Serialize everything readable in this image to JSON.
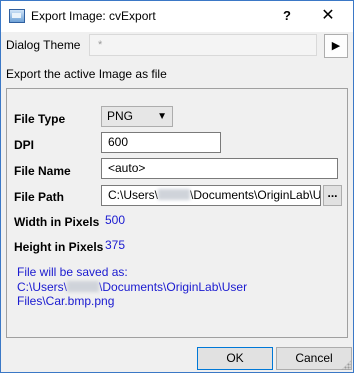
{
  "window": {
    "title": "Export Image: cvExport",
    "help_label": "?",
    "close_label": "✕"
  },
  "theme": {
    "label": "Dialog Theme",
    "value": "*",
    "arrow": "▶"
  },
  "description": "Export the active Image as file",
  "fields": {
    "file_type": {
      "label": "File Type",
      "value": "PNG",
      "chevron": "▼"
    },
    "dpi": {
      "label": "DPI",
      "value": "600"
    },
    "file_name": {
      "label": "File Name",
      "value": "<auto>"
    },
    "file_path": {
      "label": "File Path",
      "value_prefix": "C:\\Users\\",
      "value_suffix": "\\Documents\\OriginLab\\U",
      "browse_label": "..."
    },
    "width": {
      "label": "Width in Pixels",
      "value": "500"
    },
    "height": {
      "label": "Height in Pixels",
      "value": "375"
    }
  },
  "saved_note": {
    "line1": "File will be saved as:",
    "line2_prefix": "C:\\Users\\",
    "line2_suffix": "\\Documents\\OriginLab\\User",
    "line3": "Files\\Car.bmp.png"
  },
  "buttons": {
    "ok": "OK",
    "cancel": "Cancel"
  },
  "icons": {
    "app": "export-image-icon",
    "help": "question-mark-icon",
    "close": "close-icon",
    "theme_arrow": "right-arrow-icon",
    "dropdown": "chevron-down-icon"
  },
  "colors": {
    "value_text": "#1a1ad0",
    "window_border": "#3b78c6"
  }
}
